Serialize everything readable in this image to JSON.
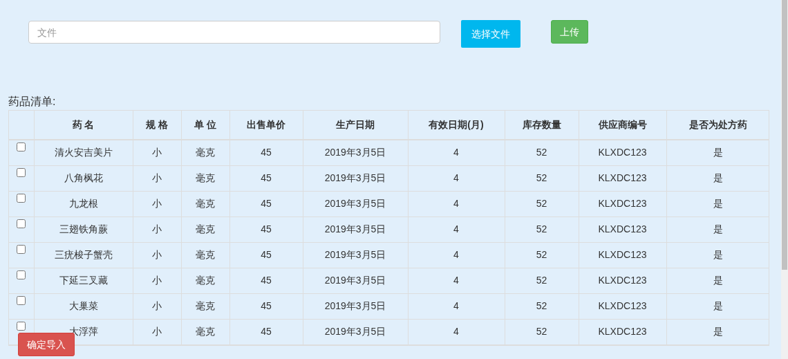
{
  "upload": {
    "file_field": {
      "placeholder": "文件"
    },
    "choose_button": "选择文件",
    "upload_button": "上传"
  },
  "list_title": "药品清单:",
  "table": {
    "columns": [
      "药 名",
      "规 格",
      "单 位",
      "出售单价",
      "生产日期",
      "有效日期(月)",
      "库存数量",
      "供应商编号",
      "是否为处方药"
    ],
    "rows": [
      {
        "checked": false,
        "cells": [
          "清火安吉美片",
          "小",
          "毫克",
          "45",
          "2019年3月5日",
          "4",
          "52",
          "KLXDC123",
          "是"
        ]
      },
      {
        "checked": false,
        "cells": [
          "八角枫花",
          "小",
          "毫克",
          "45",
          "2019年3月5日",
          "4",
          "52",
          "KLXDC123",
          "是"
        ]
      },
      {
        "checked": false,
        "cells": [
          "九龙根",
          "小",
          "毫克",
          "45",
          "2019年3月5日",
          "4",
          "52",
          "KLXDC123",
          "是"
        ]
      },
      {
        "checked": false,
        "cells": [
          "三翅铁角蕨",
          "小",
          "毫克",
          "45",
          "2019年3月5日",
          "4",
          "52",
          "KLXDC123",
          "是"
        ]
      },
      {
        "checked": false,
        "cells": [
          "三疣梭子蟹壳",
          "小",
          "毫克",
          "45",
          "2019年3月5日",
          "4",
          "52",
          "KLXDC123",
          "是"
        ]
      },
      {
        "checked": false,
        "cells": [
          "下延三叉藏",
          "小",
          "毫克",
          "45",
          "2019年3月5日",
          "4",
          "52",
          "KLXDC123",
          "是"
        ]
      },
      {
        "checked": false,
        "cells": [
          "大巢菜",
          "小",
          "毫克",
          "45",
          "2019年3月5日",
          "4",
          "52",
          "KLXDC123",
          "是"
        ]
      },
      {
        "checked": false,
        "cells": [
          "大浮萍",
          "小",
          "毫克",
          "45",
          "2019年3月5日",
          "4",
          "52",
          "KLXDC123",
          "是"
        ]
      }
    ]
  },
  "confirm_button": "确定导入"
}
